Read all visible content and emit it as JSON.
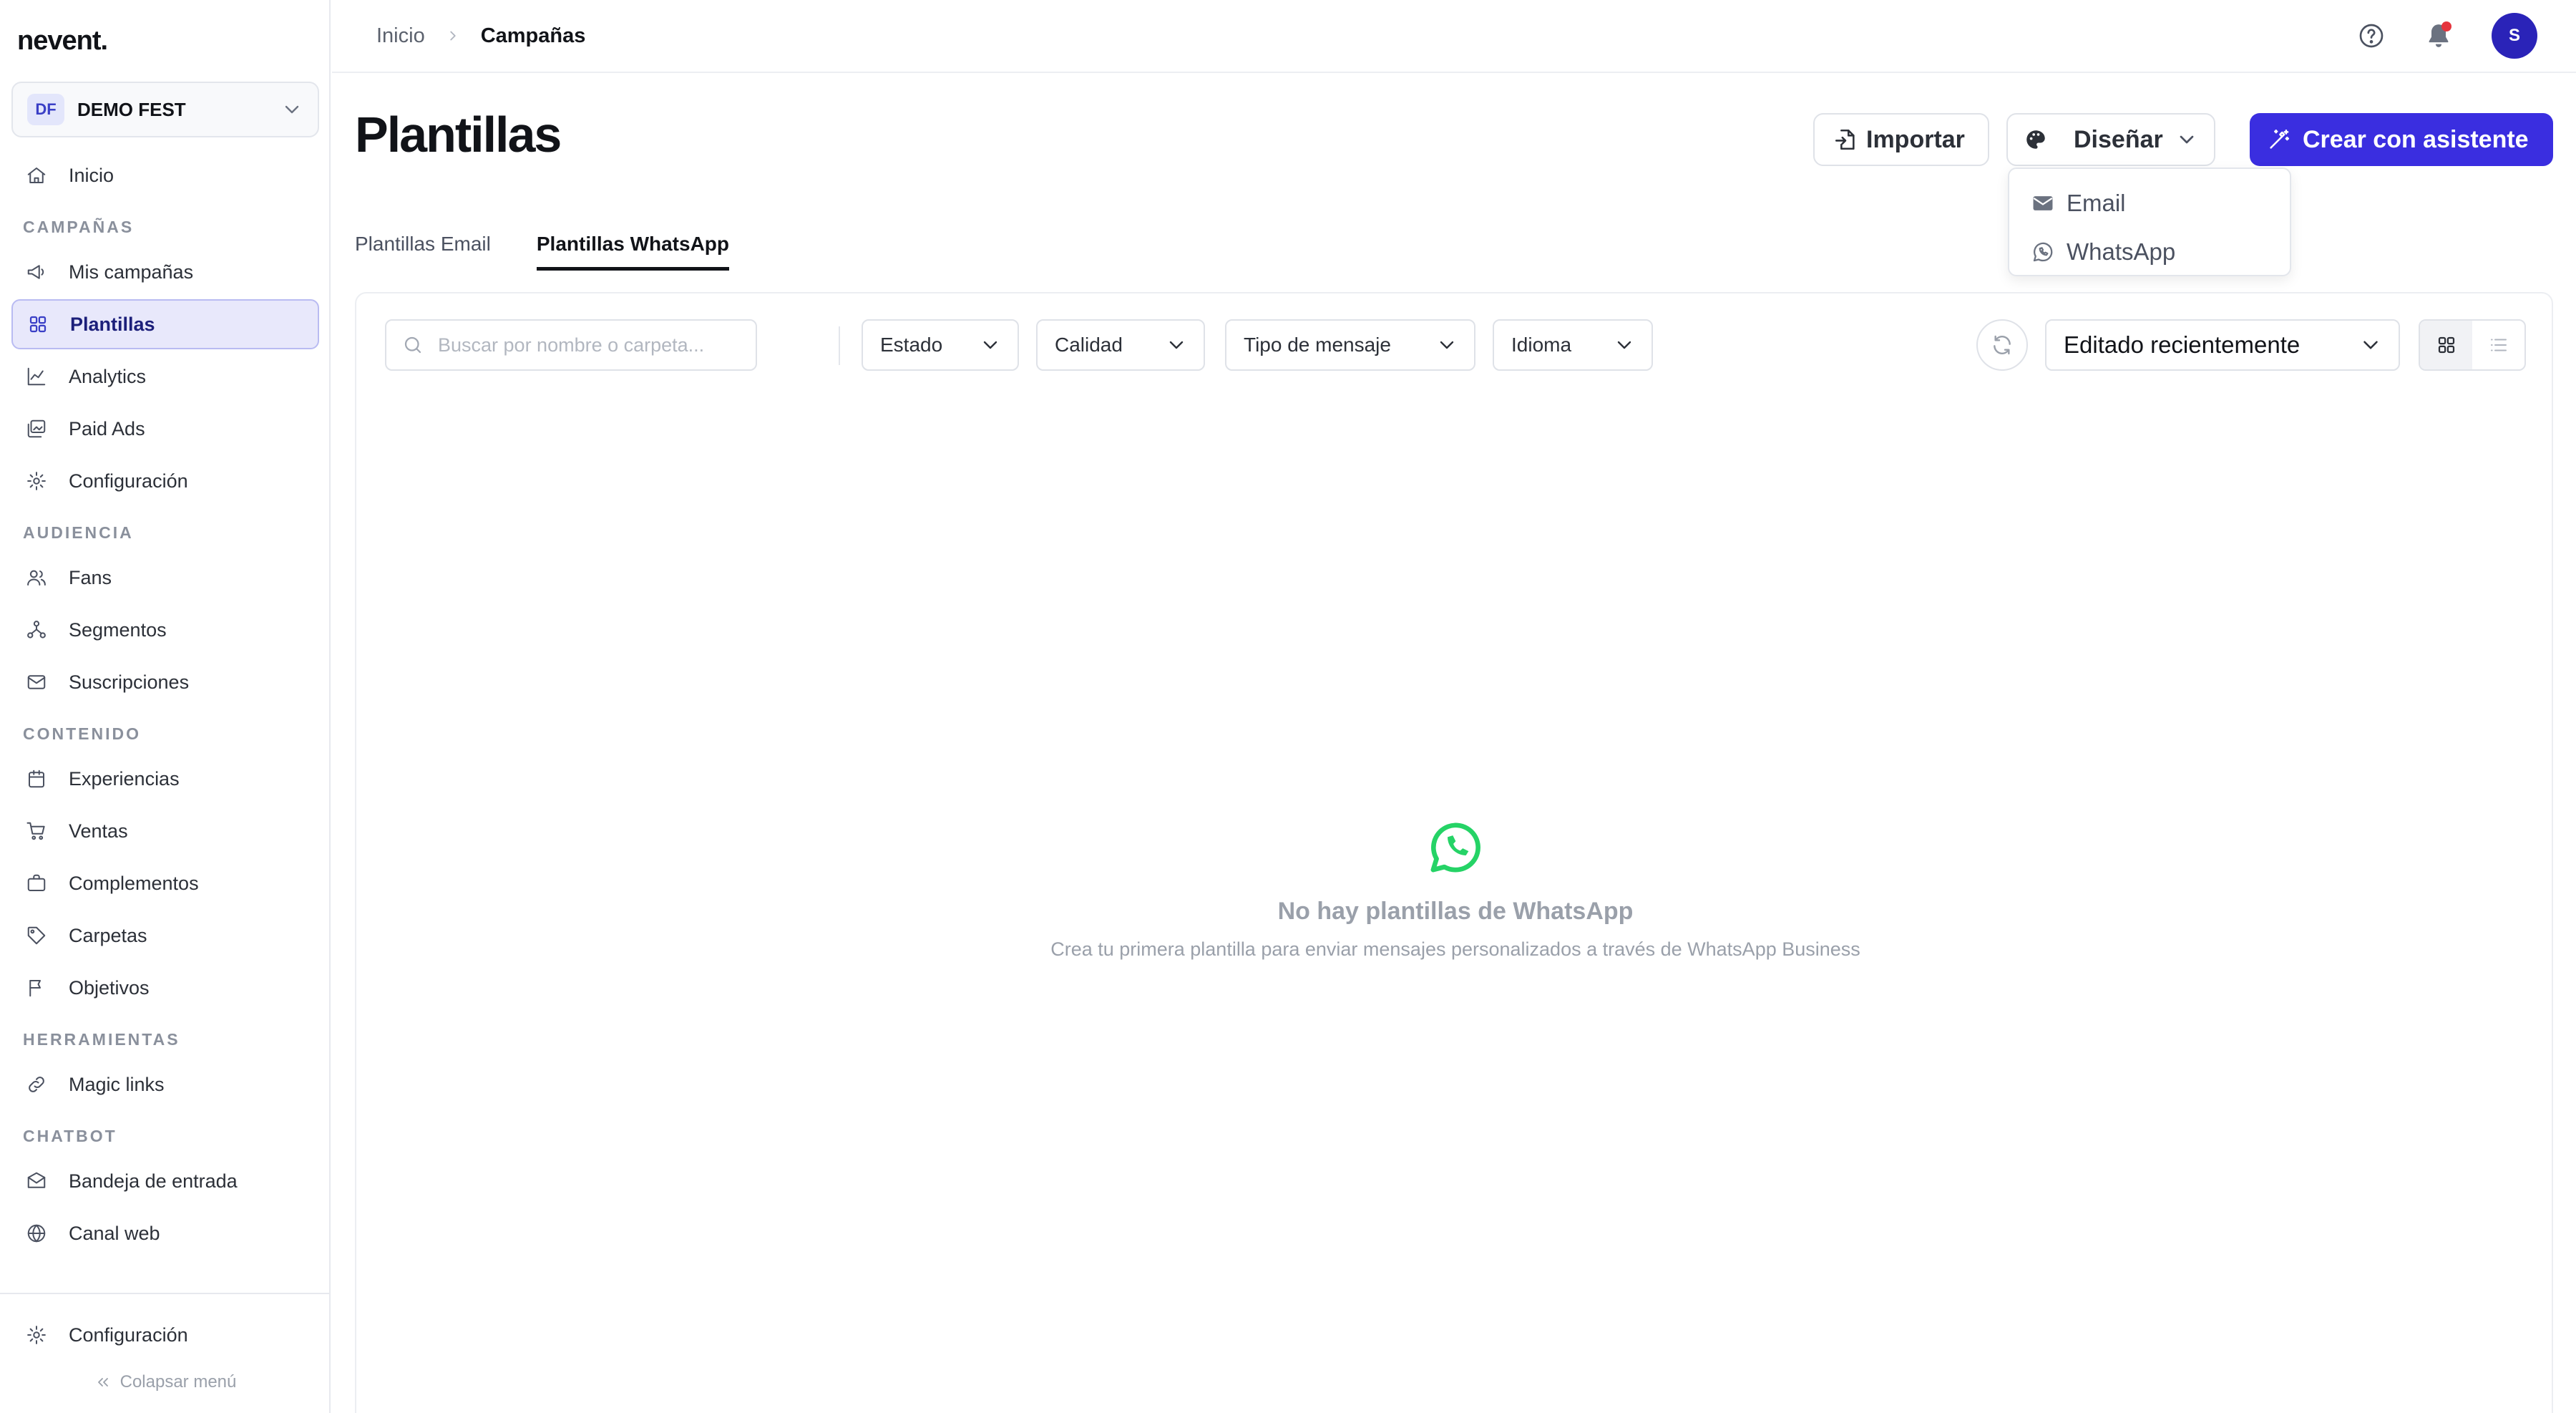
{
  "app": {
    "logo": "nevent."
  },
  "workspace": {
    "badge": "DF",
    "name": "DEMO FEST"
  },
  "sidebar": {
    "top": [
      {
        "label": "Inicio",
        "icon": "home-icon"
      }
    ],
    "sections": [
      {
        "title": "CAMPAÑAS",
        "items": [
          {
            "label": "Mis campañas",
            "icon": "megaphone-icon"
          },
          {
            "label": "Plantillas",
            "icon": "grid-icon",
            "active": true
          },
          {
            "label": "Analytics",
            "icon": "chart-line-icon"
          },
          {
            "label": "Paid Ads",
            "icon": "image-stack-icon"
          },
          {
            "label": "Configuración",
            "icon": "gear-icon"
          }
        ]
      },
      {
        "title": "AUDIENCIA",
        "items": [
          {
            "label": "Fans",
            "icon": "users-icon"
          },
          {
            "label": "Segmentos",
            "icon": "segments-icon"
          },
          {
            "label": "Suscripciones",
            "icon": "mail-icon"
          }
        ]
      },
      {
        "title": "CONTENIDO",
        "items": [
          {
            "label": "Experiencias",
            "icon": "calendar-icon"
          },
          {
            "label": "Ventas",
            "icon": "cart-icon"
          },
          {
            "label": "Complementos",
            "icon": "briefcase-icon"
          },
          {
            "label": "Carpetas",
            "icon": "tag-icon"
          },
          {
            "label": "Objetivos",
            "icon": "flag-icon"
          }
        ]
      },
      {
        "title": "HERRAMIENTAS",
        "items": [
          {
            "label": "Magic links",
            "icon": "link-icon"
          }
        ]
      },
      {
        "title": "CHATBOT",
        "items": [
          {
            "label": "Bandeja de entrada",
            "icon": "inbox-icon"
          },
          {
            "label": "Canal web",
            "icon": "globe-icon"
          }
        ]
      }
    ],
    "bottom": {
      "settings_label": "Configuración",
      "collapse_label": "Colapsar menú"
    }
  },
  "topbar": {
    "breadcrumb": [
      "Inicio",
      "Campañas"
    ]
  },
  "header": {
    "title": "Plantillas",
    "import_label": "Importar",
    "design_label": "Diseñar",
    "create_label": "Crear con asistente",
    "design_menu": [
      "Email",
      "WhatsApp"
    ]
  },
  "tabs": [
    {
      "label": "Plantillas Email",
      "active": false
    },
    {
      "label": "Plantillas WhatsApp",
      "active": true
    }
  ],
  "toolbar": {
    "search_placeholder": "Buscar por nombre o carpeta...",
    "filters": [
      "Estado",
      "Calidad",
      "Tipo de mensaje",
      "Idioma"
    ],
    "sort_value": "Editado recientemente",
    "view_mode": "grid"
  },
  "empty_state": {
    "title": "No hay plantillas de WhatsApp",
    "subtitle": "Crea tu primera plantilla para enviar mensajes personalizados a través de WhatsApp Business"
  },
  "colors": {
    "primary": "#3a2ee0",
    "active_bg": "#e8e8fb",
    "whatsapp": "#25d366",
    "notification": "#e5343d",
    "avatar": "#2a23b8"
  },
  "user": {
    "avatar_initial": "S"
  }
}
